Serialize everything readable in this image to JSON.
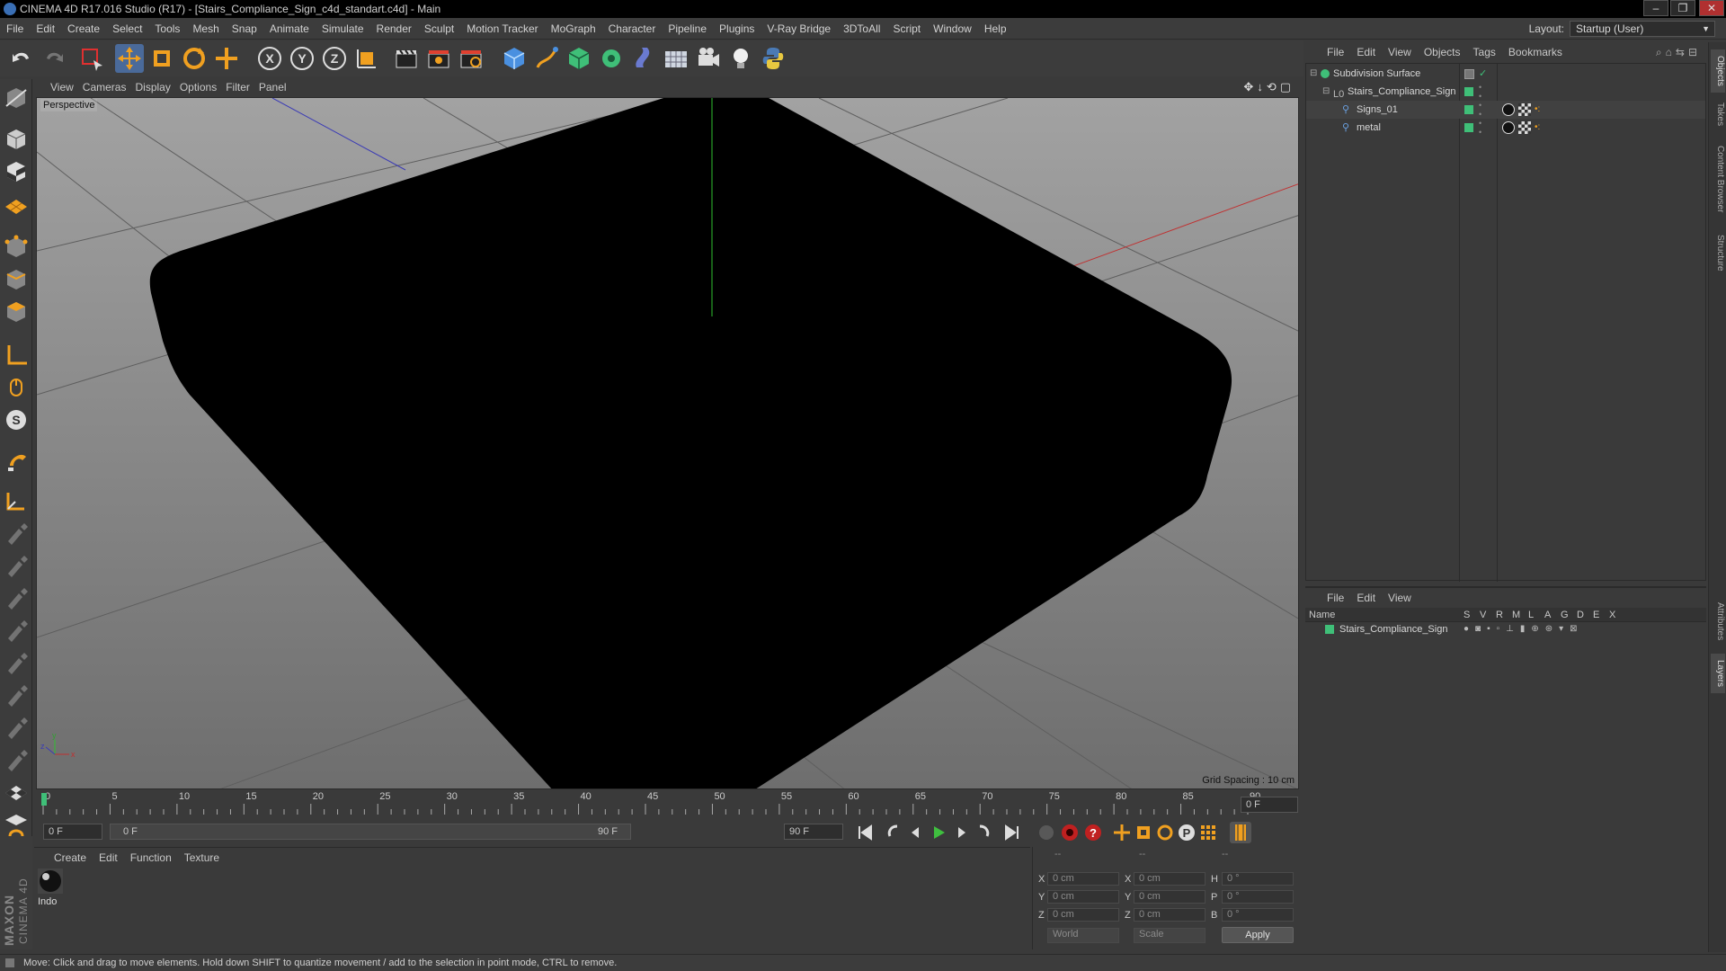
{
  "window": {
    "title": "CINEMA 4D R17.016 Studio (R17) - [Stairs_Compliance_Sign_c4d_standart.c4d] - Main",
    "controls": [
      "–",
      "❐",
      "✕"
    ]
  },
  "menubar": {
    "items": [
      "File",
      "Edit",
      "Create",
      "Select",
      "Tools",
      "Mesh",
      "Snap",
      "Animate",
      "Simulate",
      "Render",
      "Sculpt",
      "Motion Tracker",
      "MoGraph",
      "Character",
      "Pipeline",
      "Plugins",
      "V-Ray Bridge",
      "3DToAll",
      "Script",
      "Window",
      "Help"
    ],
    "layout_label": "Layout:",
    "layout_value": "Startup (User)"
  },
  "viewport": {
    "menu": [
      "View",
      "Cameras",
      "Display",
      "Options",
      "Filter",
      "Panel"
    ],
    "camera_label": "Perspective",
    "grid_spacing": "Grid Spacing : 10 cm",
    "axis_labels": [
      "y",
      "x",
      "z"
    ]
  },
  "timeline": {
    "ticks": [
      "0",
      "5",
      "10",
      "15",
      "20",
      "25",
      "30",
      "35",
      "40",
      "45",
      "50",
      "55",
      "60",
      "65",
      "70",
      "75",
      "80",
      "85",
      "90"
    ],
    "current_frame": "0 F",
    "start_frame": "0 F",
    "range_start": "0 F",
    "range_end": "90 F",
    "end_frame": "90 F",
    "end_field": "0 F"
  },
  "material_manager": {
    "menu": [
      "Create",
      "Edit",
      "Function",
      "Texture"
    ],
    "material_name": "Indo"
  },
  "coordinates": {
    "headers": [
      "--",
      "--",
      "--"
    ],
    "rows": [
      {
        "axis": "X",
        "pos": "0 cm",
        "axis2": "X",
        "size": "0 cm",
        "rlabel": "H",
        "rot": "0 °"
      },
      {
        "axis": "Y",
        "pos": "0 cm",
        "axis2": "Y",
        "size": "0 cm",
        "rlabel": "P",
        "rot": "0 °"
      },
      {
        "axis": "Z",
        "pos": "0 cm",
        "axis2": "Z",
        "size": "0 cm",
        "rlabel": "B",
        "rot": "0 °"
      }
    ],
    "mode1": "World",
    "mode2": "Scale",
    "apply": "Apply"
  },
  "object_manager": {
    "menu": [
      "File",
      "Edit",
      "View",
      "Objects",
      "Tags",
      "Bookmarks"
    ],
    "objects": [
      {
        "name": "Subdivision Surface"
      },
      {
        "name": "Stairs_Compliance_Sign"
      },
      {
        "name": "Signs_01"
      },
      {
        "name": "metal"
      }
    ]
  },
  "layer_manager": {
    "menu": [
      "File",
      "Edit",
      "View"
    ],
    "columns": [
      "Name",
      "S",
      "V",
      "R",
      "M",
      "L",
      "A",
      "G",
      "D",
      "E",
      "X"
    ],
    "layers": [
      {
        "name": "Stairs_Compliance_Sign"
      }
    ]
  },
  "right_tabs": [
    "Objects",
    "Takes",
    "Content Browser",
    "Structure",
    "Attributes",
    "Layers"
  ],
  "status": "Move: Click and drag to move elements. Hold down SHIFT to quantize movement / add to the selection in point mode, CTRL to remove.",
  "brand": {
    "maxon": "MAXON",
    "cinema": "CINEMA 4D"
  },
  "colors": {
    "accent_green": "#3fbf78",
    "accent_orange": "#f0a020",
    "viewport_bg": "#8a8a8a",
    "object_black": "#000000"
  }
}
